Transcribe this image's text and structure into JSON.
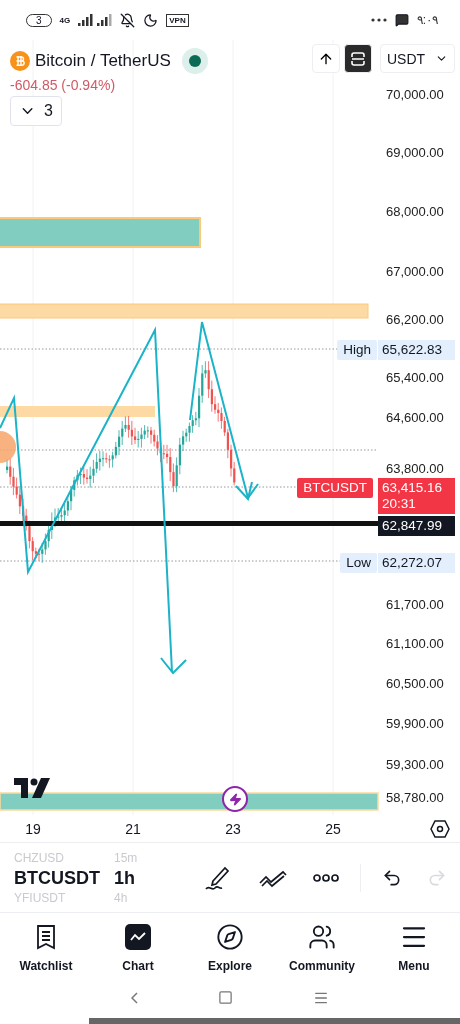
{
  "status_bar": {
    "sim_badge": "3",
    "network": "4G",
    "vpn": "VPN",
    "time": "٩:٠٩"
  },
  "header": {
    "symbol": "Bitcoin / TetherUS",
    "market_open": true,
    "change": "-604.85 (-0.94%)",
    "indicators_count": "3",
    "currency": "USDT"
  },
  "price_axis": [
    "70,000.00",
    "69,000.00",
    "68,000.00",
    "67,000.00",
    "66,200.00",
    "65,400.00",
    "64,600.00",
    "63,800.00",
    "61,700.00",
    "61,100.00",
    "60,500.00",
    "59,900.00",
    "59,300.00",
    "58,780.00"
  ],
  "price_labels": [
    {
      "kind": "high",
      "label": "High",
      "value": "65,622.83"
    },
    {
      "kind": "last",
      "label": "BTCUSDT",
      "value": "63,415.16",
      "countdown": "20:31"
    },
    {
      "kind": "line",
      "value": "62,847.99"
    },
    {
      "kind": "low",
      "label": "Low",
      "value": "62,272.07"
    }
  ],
  "date_axis": [
    "19",
    "21",
    "23",
    "25"
  ],
  "symbol_picker": [
    {
      "symbol": "CHZUSD",
      "interval": "15m",
      "selected": false
    },
    {
      "symbol": "BTCUSDT",
      "interval": "1h",
      "selected": true
    },
    {
      "symbol": "YFIUSDT",
      "interval": "4h",
      "selected": false
    }
  ],
  "toolbar": {
    "redo_disabled": true
  },
  "nav": [
    {
      "label": "Watchlist",
      "selected": false
    },
    {
      "label": "Chart",
      "selected": true
    },
    {
      "label": "Explore",
      "selected": false
    },
    {
      "label": "Community",
      "selected": false
    },
    {
      "label": "Menu",
      "selected": false
    }
  ]
}
